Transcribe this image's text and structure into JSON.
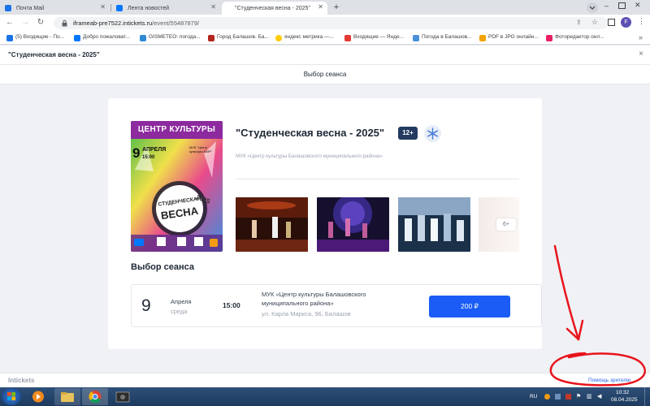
{
  "browser": {
    "tabs": [
      {
        "label": "Почта Mail",
        "icon": "mail-icon",
        "color": "#1a73e8",
        "active": false
      },
      {
        "label": "Лента новостей",
        "icon": "vk-icon",
        "color": "#0077ff",
        "active": false
      },
      {
        "label": "\"Студенческая весна - 2025\"",
        "icon": "",
        "color": "",
        "active": true
      }
    ],
    "new_tab": "+",
    "url_host": "iframeab-pre7522.intickets.ru",
    "url_path": "/event/55487879/",
    "profile_letter": "F"
  },
  "bookmarks": [
    {
      "label": "(5) Входящие - По...",
      "color": "#1a73e8"
    },
    {
      "label": "Добро пожаловат...",
      "color": "#0077ff"
    },
    {
      "label": "GISMETEO: погода...",
      "color": "#2f8ad6"
    },
    {
      "label": "Город Балашов. Ба...",
      "color": "#b3261e"
    },
    {
      "label": "яндекс метрика —...",
      "color": "#ffcc00"
    },
    {
      "label": "Входящие — Янде...",
      "color": "#e53935"
    },
    {
      "label": "Погода в Балашов...",
      "color": "#4a90d9"
    },
    {
      "label": "PDF в JPG онлайн...",
      "color": "#f4a300"
    },
    {
      "label": "Фоторедактор онл...",
      "color": "#e91e63"
    }
  ],
  "page": {
    "title": "\"Студенческая весна - 2025\"",
    "close": "×",
    "step": "Выбор сеанса"
  },
  "event": {
    "title": "\"Студенческая весна - 2025\"",
    "age": "12+",
    "organizer": "МУК «Центр культуры Балашовского муниципального района»",
    "poster": {
      "header": "ЦЕНТР КУЛЬТУРЫ",
      "day": "9",
      "month": "АПРЕЛЯ",
      "time": "15:00",
      "org_lines": [
        "МУК \"Центр",
        "культуры БМР\""
      ],
      "word1": "СТУДЕНЧЕСКАЯ",
      "word2": "ВЕСНА",
      "year": "2025"
    },
    "more_photos": "6+"
  },
  "sessions": {
    "heading": "Выбор сеанса",
    "items": [
      {
        "day": "9",
        "month": "Апреля",
        "weekday": "среда",
        "time": "15:00",
        "venue": "МУК «Центр культуры Балашовского муниципального района»",
        "address": "ул. Карла Маркса, 96, Балашов",
        "price": "200 ₽"
      }
    ]
  },
  "footer": {
    "logo": "Intickets",
    "help": "Помощь зрителю"
  },
  "taskbar": {
    "lang": "RU",
    "time": "10:32",
    "date": "08.04.2025"
  },
  "colors": {
    "accent": "#1a5cf5",
    "badge": "#243b60",
    "annotation": "#e8141c"
  }
}
